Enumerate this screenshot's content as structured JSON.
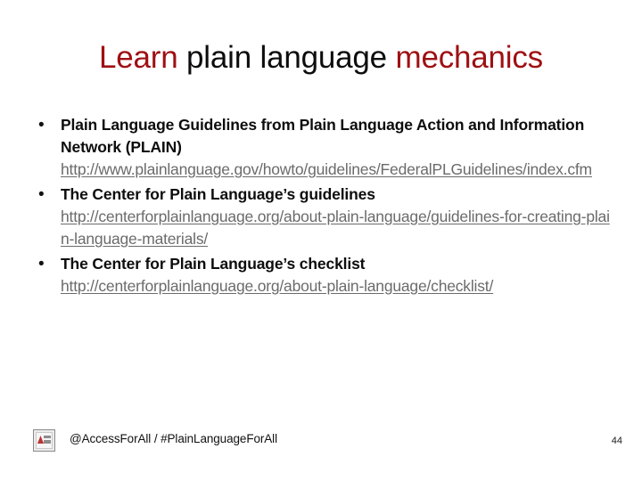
{
  "slide": {
    "page_number": "44",
    "title": {
      "segments": [
        {
          "text": "Learn ",
          "color": "#9e1013"
        },
        {
          "text": "plain language ",
          "color": "#0d0d0d"
        },
        {
          "text": "mechanics",
          "color": "#9e1013"
        }
      ],
      "part1": "Learn ",
      "part2": "plain language ",
      "part3": "mechanics"
    },
    "bullets": [
      {
        "marker": "•",
        "heading": "Plain Language Guidelines from Plain Language Action and Information Network (PLAIN)",
        "url": "http://www.plainlanguage.gov/howto/guidelines/FederalPLGuidelines/index.cfm"
      },
      {
        "marker": "•",
        "heading": "The Center for Plain Language’s guidelines",
        "url": "http://centerforplainlanguage.org/about-plain-language/guidelines-for-creating-plain-language-materials/"
      },
      {
        "marker": "•",
        "heading": "The Center for Plain Language’s checklist",
        "url": "http://centerforplainlanguage.org/about-plain-language/checklist/"
      }
    ],
    "footer": {
      "logo_alt": "broken-image-placeholder",
      "text": "@AccessForAll / #PlainLanguageForAll"
    }
  },
  "colors": {
    "title_accent": "#9e1013",
    "title_body": "#0d0d0d",
    "link": "#6b6b6b",
    "background": "#ffffff"
  }
}
